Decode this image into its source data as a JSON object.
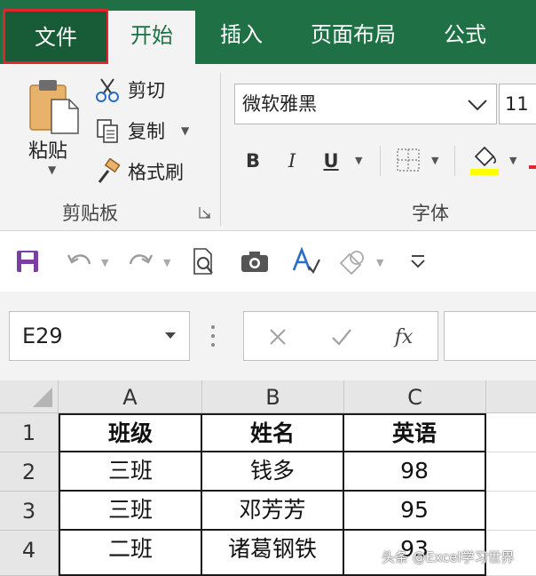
{
  "tabs": [
    {
      "label": "文件",
      "state": "highlighted"
    },
    {
      "label": "开始",
      "state": "active"
    },
    {
      "label": "插入",
      "state": "normal"
    },
    {
      "label": "页面布局",
      "state": "normal"
    },
    {
      "label": "公式",
      "state": "normal"
    }
  ],
  "clipboard": {
    "paste_label": "粘贴",
    "cut_label": "剪切",
    "copy_label": "复制",
    "format_painter_label": "格式刷",
    "group_label": "剪贴板"
  },
  "font": {
    "name": "微软雅黑",
    "size": "11",
    "bold_label": "B",
    "italic_label": "I",
    "underline_label": "U",
    "group_label": "字体"
  },
  "name_box": "E29",
  "formula_bar": {
    "cancel_icon": "close-icon",
    "enter_icon": "check-icon",
    "fx_label": "fx"
  },
  "columns": [
    "A",
    "B",
    "C"
  ],
  "rows": [
    "1",
    "2",
    "3",
    "4"
  ],
  "table": {
    "header": [
      "班级",
      "姓名",
      "英语"
    ],
    "data": [
      [
        "三班",
        "钱多",
        "98"
      ],
      [
        "三班",
        "邓芳芳",
        "95"
      ],
      [
        "二班",
        "诸葛钢铁",
        "93"
      ]
    ]
  },
  "watermark": "头条 @Excel学习世界",
  "colors": {
    "tab_bar": "#1f7145",
    "file_tab": "#185c37",
    "highlight_border": "#e0262a",
    "ribbon": "#f3f3f3",
    "save_icon": "#7b3fa1"
  }
}
